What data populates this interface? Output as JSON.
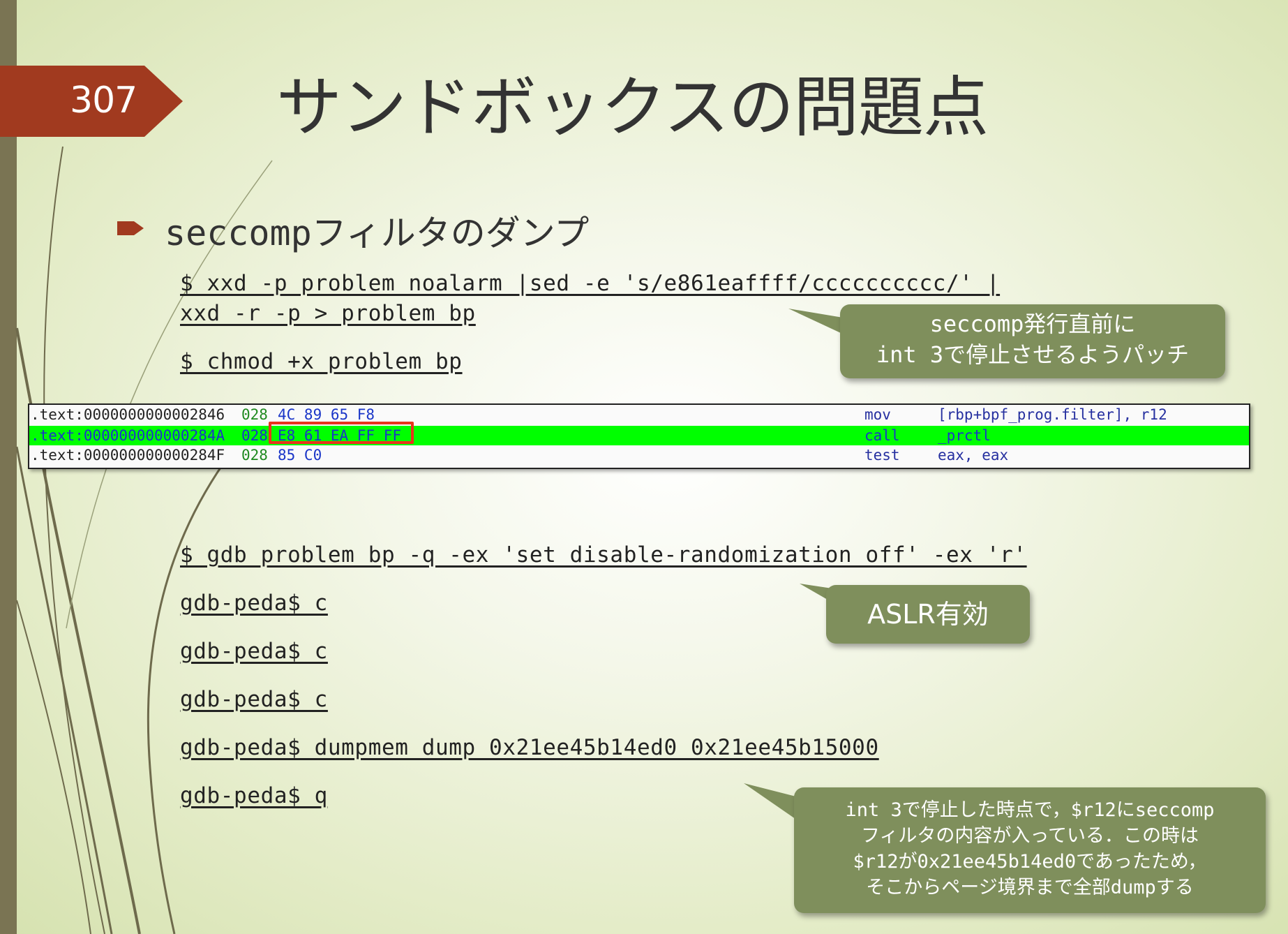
{
  "slide": {
    "number": "307",
    "title": "サンドボックスの問題点",
    "bullet": "seccompフィルタのダンプ"
  },
  "commands": {
    "xxd_line1": "$ xxd -p problem_noalarm |sed -e 's/e861eaffff/cccccccccc/' |",
    "xxd_line2": "xxd -r -p > problem_bp",
    "chmod": "$ chmod +x problem_bp",
    "gdb_run": "$ gdb problem_bp -q -ex 'set disable-randomization off' -ex 'r'",
    "gdb_c1": "gdb-peda$ c",
    "gdb_c2": "gdb-peda$ c",
    "gdb_c3": "gdb-peda$ c",
    "dumpmem": "gdb-peda$ dumpmem dump 0x21ee45b14ed0 0x21ee45b15000",
    "quit": "gdb-peda$ q"
  },
  "disassembly": [
    {
      "addr": ".text:0000000000002846",
      "sp": "028",
      "bytes": "4C 89 65 F8",
      "mnemonic": "mov",
      "operands": "[rbp+bpf_prog.filter], r12"
    },
    {
      "addr": ".text:000000000000284A",
      "sp": "028",
      "bytes": "E8 61 EA FF FF",
      "mnemonic": "call",
      "operands": "_prctl"
    },
    {
      "addr": ".text:000000000000284F",
      "sp": "028",
      "bytes": "85 C0",
      "mnemonic": "test",
      "operands": "eax, eax"
    }
  ],
  "callouts": {
    "patch": {
      "line1": "seccomp発行直前に",
      "line2": "int 3で停止させるようパッチ"
    },
    "aslr": "ASLR有効",
    "note": {
      "line1": "int 3で停止した時点で，$r12にseccomp",
      "line2": "フィルタの内容が入っている．この時は",
      "line3": "$r12が0x21ee45b14ed0であったため，",
      "line4": "そこからページ境界まで全部dumpする"
    }
  },
  "colors": {
    "background": "#eef3dc",
    "left_bar": "#7a7453",
    "slide_number_bg": "#a13a1f",
    "callout_bg": "#7f8f5c",
    "highlight_row": "#00ff00",
    "highlight_box": "#e8341c"
  }
}
